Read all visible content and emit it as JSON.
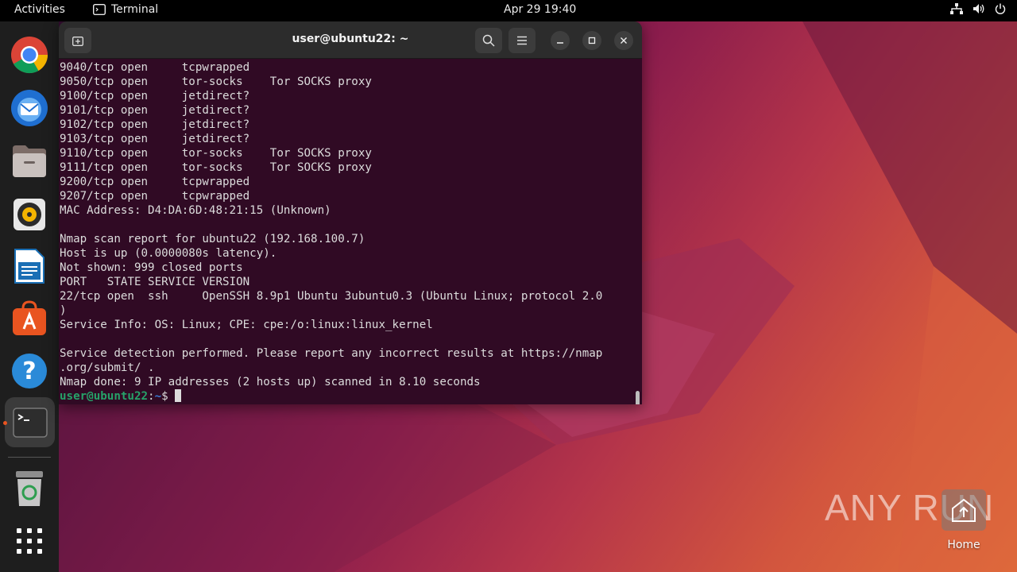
{
  "topbar": {
    "activities": "Activities",
    "app_name": "Terminal",
    "clock": "Apr 29  19:40"
  },
  "dock": {
    "items": [
      "chrome-icon",
      "thunderbird-icon",
      "files-icon",
      "rhythmbox-icon",
      "libreoffice-writer-icon",
      "app-center-icon",
      "help-icon",
      "terminal-icon",
      "trash-icon",
      "show-apps-icon"
    ]
  },
  "terminal": {
    "title": "user@ubuntu22: ~",
    "lines": [
      "9040/tcp open     tcpwrapped",
      "9050/tcp open     tor-socks    Tor SOCKS proxy",
      "9100/tcp open     jetdirect?",
      "9101/tcp open     jetdirect?",
      "9102/tcp open     jetdirect?",
      "9103/tcp open     jetdirect?",
      "9110/tcp open     tor-socks    Tor SOCKS proxy",
      "9111/tcp open     tor-socks    Tor SOCKS proxy",
      "9200/tcp open     tcpwrapped",
      "9207/tcp open     tcpwrapped",
      "MAC Address: D4:DA:6D:48:21:15 (Unknown)",
      "",
      "Nmap scan report for ubuntu22 (192.168.100.7)",
      "Host is up (0.0000080s latency).",
      "Not shown: 999 closed ports",
      "PORT   STATE SERVICE VERSION",
      "22/tcp open  ssh     OpenSSH 8.9p1 Ubuntu 3ubuntu0.3 (Ubuntu Linux; protocol 2.0",
      ")",
      "Service Info: OS: Linux; CPE: cpe:/o:linux:linux_kernel",
      "",
      "Service detection performed. Please report any incorrect results at https://nmap",
      ".org/submit/ .",
      "Nmap done: 9 IP addresses (2 hosts up) scanned in 8.10 seconds"
    ],
    "prompt_user": "user@ubuntu22",
    "prompt_sep": ":",
    "prompt_path": "~",
    "prompt_symbol": "$"
  },
  "desktop": {
    "watermark": "ANY RUN",
    "home_label": "Home"
  },
  "colors": {
    "terminal_bg": "#300a24",
    "prompt_user": "#26a269",
    "prompt_path": "#3a7bd5",
    "accent": "#e95420"
  }
}
